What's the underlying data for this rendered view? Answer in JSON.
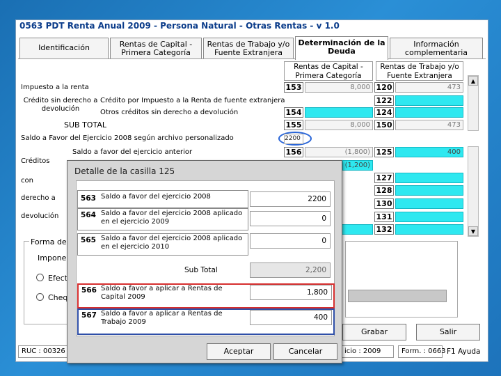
{
  "window_title": "0563 PDT Renta Anual 2009 - Persona Natural - Otras Rentas - v 1.0",
  "tabs": [
    {
      "label": "Identificación"
    },
    {
      "label": "Rentas de Capital - Primera Categoría"
    },
    {
      "label": "Rentas de Trabajo y/o Fuente Extranjera"
    },
    {
      "label": "Determinación de la Deuda"
    },
    {
      "label": "Información complementaria"
    }
  ],
  "columns": {
    "col1": "Rentas de Capital - Primera Categoría",
    "col2": "Rentas de Trabajo y/o Fuente Extranjera"
  },
  "rows": {
    "impuesto": {
      "label": "Impuesto a la renta",
      "code1": "153",
      "val1": "8,000",
      "code2": "120",
      "val2": "473"
    },
    "credito_label": "Crédito sin derecho a devolución",
    "credito_ext": {
      "label": "Crédito por Impuesto a la Renta de fuente extranjera",
      "code2": "122"
    },
    "otros": {
      "label": "Otros créditos sin derecho a devolución",
      "code1": "154",
      "code2": "124"
    },
    "subtotal": {
      "label": "SUB TOTAL",
      "code1": "155",
      "val1": "8,000",
      "code2": "150",
      "val2": "473"
    },
    "saldo_favor": {
      "label": "Saldo a Favor del Ejercicio 2008 según archivo personalizado",
      "value": "2200"
    },
    "saldo_anterior": {
      "label": "Saldo a favor del ejercicio anterior",
      "code1": "156",
      "val1": "(1,800)",
      "code2": "125",
      "val2": "400"
    },
    "creditos_labels": [
      "Créditos",
      "con",
      "derecho a",
      "devolución"
    ],
    "extra_val1": "(1,200)",
    "codes_right": [
      "127",
      "128",
      "130",
      "131",
      "132"
    ]
  },
  "left_fragments": {
    "forma": "Forma de",
    "impone": "Impone",
    "efect": "Efect",
    "cheq": "Cheq"
  },
  "bottom_buttons": {
    "grabar": "Grabar",
    "salir": "Salir"
  },
  "status": {
    "ruc": "RUC : 00326",
    "ejercicio": "icio : 2009",
    "form": "Form. : 0663",
    "ayuda": "F1 Ayuda"
  },
  "dialog": {
    "title": "Detalle de la casilla 125",
    "rows": [
      {
        "code": "563",
        "desc": "Saldo a favor del ejercicio 2008",
        "value": "2200"
      },
      {
        "code": "564",
        "desc": "Saldo a favor del ejercicio 2008 aplicado en el ejercicio 2009",
        "value": "0"
      },
      {
        "code": "565",
        "desc": "Saldo a favor del ejercicio 2008 aplicado en el ejercicio 2010",
        "value": "0"
      }
    ],
    "subtotal_label": "Sub Total",
    "subtotal_value": "2,200",
    "rows2": [
      {
        "code": "566",
        "desc": "Saldo a favor a aplicar a Rentas de Capital 2009",
        "value": "1,800"
      },
      {
        "code": "567",
        "desc": "Saldo a favor a aplicar a Rentas de Trabajo 2009",
        "value": "400"
      }
    ],
    "aceptar": "Aceptar",
    "cancelar": "Cancelar"
  }
}
